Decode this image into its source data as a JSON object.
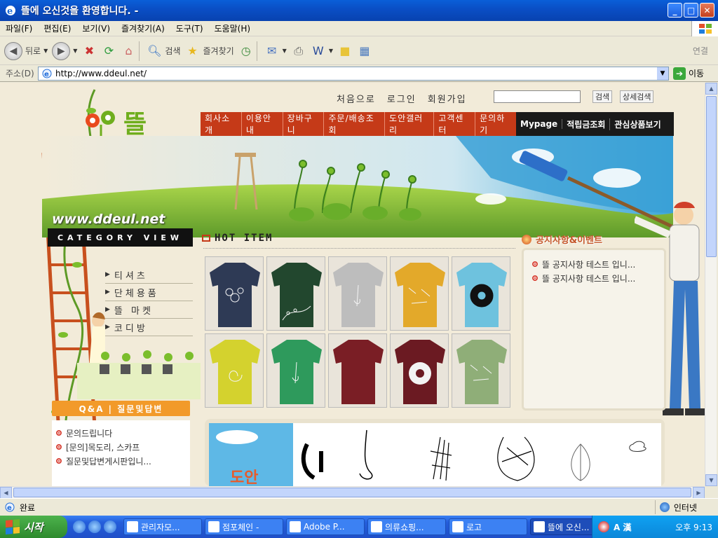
{
  "window": {
    "title": "뜰에 오신것을 환영합니다. -",
    "controls": [
      "minimize",
      "maximize",
      "close"
    ]
  },
  "menu": [
    "파일(F)",
    "편집(E)",
    "보기(V)",
    "즐겨찾기(A)",
    "도구(T)",
    "도움말(H)"
  ],
  "toolbar": {
    "back": "뒤로",
    "search": "검색",
    "favorites": "즐겨찾기",
    "links": "연결"
  },
  "address": {
    "label": "주소(D)",
    "url": "http://www.ddeul.net/",
    "go": "이동"
  },
  "site": {
    "logo_text": "뜰",
    "top_links": [
      "처음으로",
      "로그인",
      "회원가입"
    ],
    "search_btn": "검색",
    "detail_search_btn": "상세검색",
    "nav_main": [
      "회사소개",
      "이용안내",
      "장바구니",
      "주문/배송조회",
      "도안갤러리",
      "고객센터",
      "문의하기"
    ],
    "nav_member": [
      "Mypage",
      "적립금조회",
      "관심상품보기"
    ],
    "url_text": "www.ddeul.net",
    "category_view": "CATEGORY VIEW",
    "categories": [
      "티셔츠",
      "단체용품",
      "뜰 마켓",
      "코디방"
    ],
    "qna_title": "Q&A | 질문및답변",
    "qna_items": [
      "문의드립니다",
      "[문의]목도리, 스카프",
      "질문및답변게시판입니..."
    ],
    "hot_item": "HOT ITEM",
    "notice_title": "공지사항&이벤트",
    "notices": [
      "뜰 공지사항 테스트 입니...",
      "뜰 공지사항 테스트 입니..."
    ],
    "doan_label": "도안",
    "products": [
      {
        "color": "#2E3A55",
        "print": "circles"
      },
      {
        "color": "#22472E",
        "print": "dots"
      },
      {
        "color": "#BDBDBD",
        "print": "line"
      },
      {
        "color": "#E3A92A",
        "print": "sketch"
      },
      {
        "color": "#6EC2DE",
        "print": "mandala"
      },
      {
        "color": "#D4D22E",
        "print": "swirl"
      },
      {
        "color": "#2E9A5C",
        "print": "line"
      },
      {
        "color": "#7A1E25",
        "print": "none"
      },
      {
        "color": "#6B1A22",
        "print": "flower"
      },
      {
        "color": "#8FAE78",
        "print": "sketch"
      }
    ]
  },
  "status": {
    "text": "완료",
    "zone": "인터넷"
  },
  "taskbar": {
    "start": "시작",
    "tasks": [
      "관리자모...",
      "점포체인 -",
      "Adobe P...",
      "의류쇼핑...",
      "로고",
      "뜰에 오신..."
    ],
    "active_task": 5,
    "clock": "오후 9:13"
  }
}
